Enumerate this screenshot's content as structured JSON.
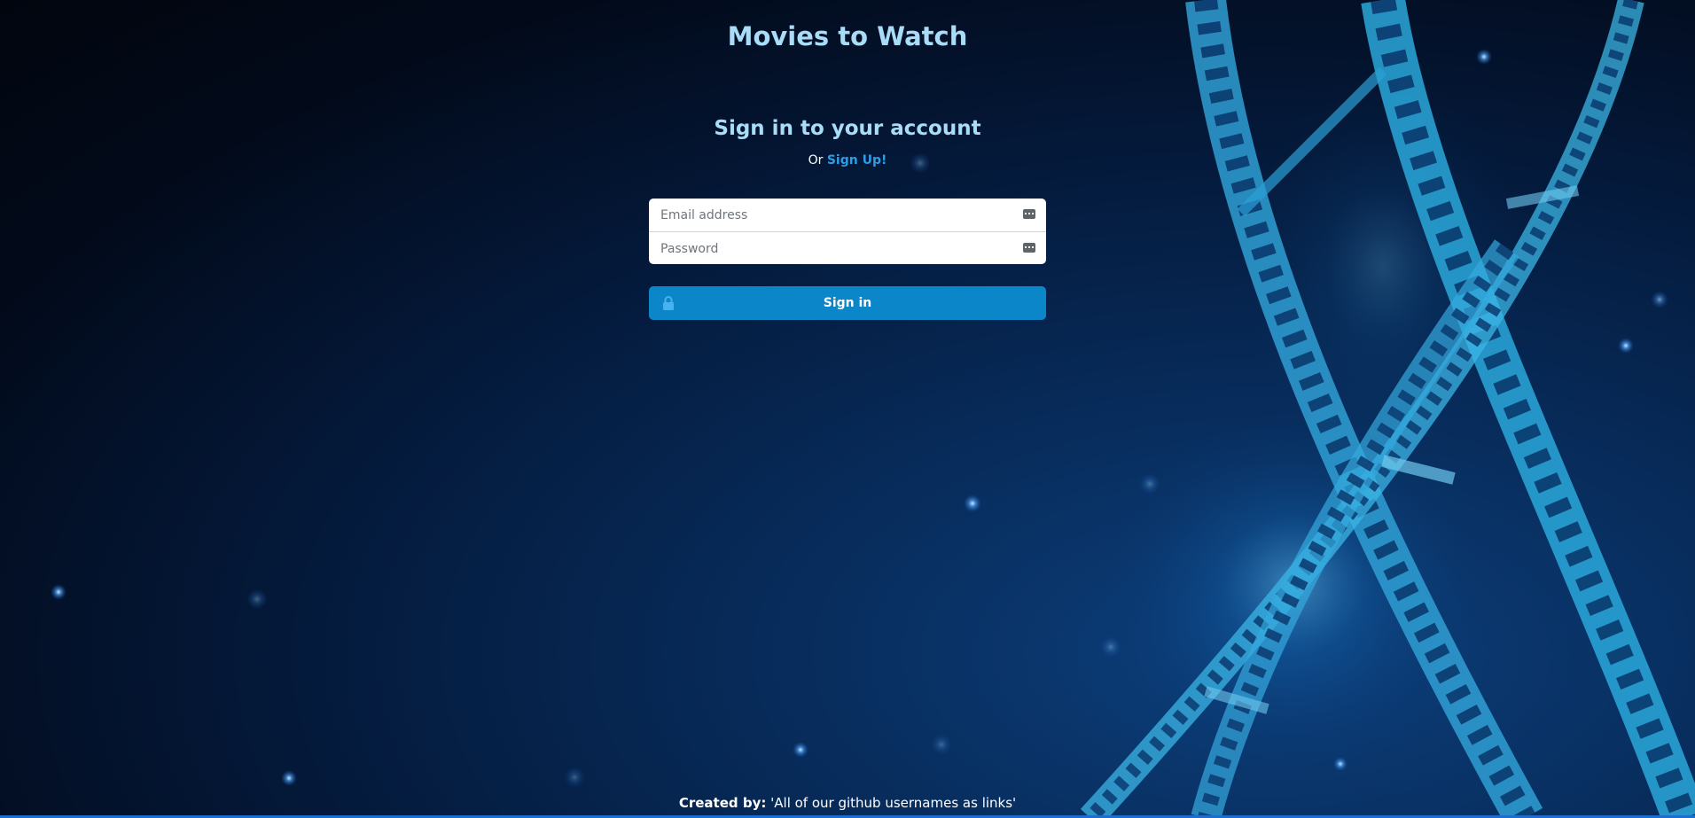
{
  "header": {
    "title": "Movies to Watch"
  },
  "form": {
    "heading": "Sign in to your account",
    "signup_prefix": "Or",
    "signup_link": "Sign Up!",
    "email_placeholder": "Email address",
    "password_placeholder": "Password",
    "signin_label": "Sign in"
  },
  "footer": {
    "label": "Created by:",
    "text": "'All of our github usernames as links'"
  },
  "icons": {
    "input_icon": "key-icon",
    "signin_icon": "lock-icon"
  },
  "colors": {
    "title": "#a9dcf6",
    "link": "#2a9ee6",
    "button": "#0b86c9",
    "background": "#04193a"
  }
}
